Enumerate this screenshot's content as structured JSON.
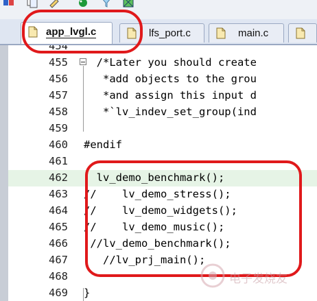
{
  "tabs": [
    {
      "label": "app_lvgl.c",
      "active": true
    },
    {
      "label": "lfs_port.c",
      "active": false
    },
    {
      "label": "main.c",
      "active": false
    }
  ],
  "toolbar_icons": [
    "build-icon",
    "copy-icon",
    "debug-icon",
    "filter-icon",
    "map-icon"
  ],
  "lines": [
    {
      "num": "454",
      "code": "",
      "kind": "plain"
    },
    {
      "num": "455",
      "code": "  /*Later you should create",
      "kind": "comment"
    },
    {
      "num": "456",
      "code": "   *add objects to the grou",
      "kind": "comment"
    },
    {
      "num": "457",
      "code": "   *and assign this input d",
      "kind": "comment"
    },
    {
      "num": "458",
      "code": "   *`lv_indev_set_group(ind",
      "kind": "comment"
    },
    {
      "num": "459",
      "code": "",
      "kind": "plain"
    },
    {
      "num": "460",
      "code": "#endif",
      "kind": "prep"
    },
    {
      "num": "461",
      "code": "",
      "kind": "plain"
    },
    {
      "num": "462",
      "code": "  lv_demo_benchmark();",
      "kind": "plain"
    },
    {
      "num": "463",
      "code": "//    lv_demo_stress();",
      "kind": "comment"
    },
    {
      "num": "464",
      "code": "//    lv_demo_widgets();",
      "kind": "comment"
    },
    {
      "num": "465",
      "code": "//    lv_demo_music();",
      "kind": "comment"
    },
    {
      "num": "466",
      "code": " //lv_demo_benchmark();",
      "kind": "comment"
    },
    {
      "num": "467",
      "code": "   //lv_prj_main();",
      "kind": "comment"
    },
    {
      "num": "468",
      "code": "",
      "kind": "plain"
    },
    {
      "num": "469",
      "code": "}",
      "kind": "plain"
    }
  ],
  "watermark": "电子发烧友",
  "colors": {
    "annotation": "#e0191b",
    "comment": "#2c7a2c",
    "highlight": "#e6f4e6"
  }
}
